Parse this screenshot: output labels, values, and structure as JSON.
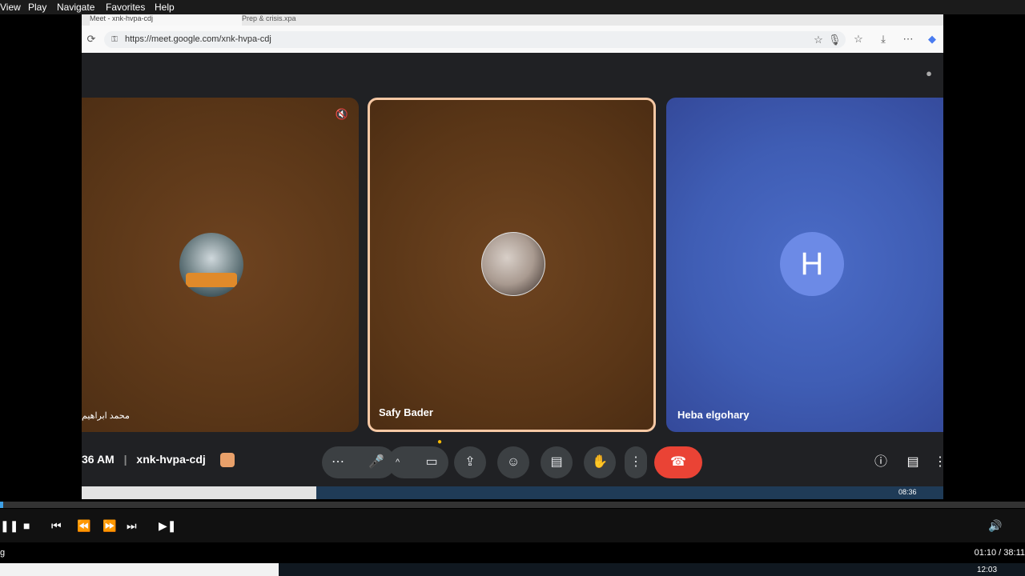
{
  "player": {
    "menu": [
      "View",
      "Play",
      "Navigate",
      "Favorites",
      "Help"
    ],
    "time": "01:10 / 38:11",
    "status_left": "g"
  },
  "browser": {
    "tab1_title": "Meet - xnk-hvpa-cdj",
    "tab2_title": "Prep & crisis.xpa",
    "url": "https://meet.google.com/xnk-hvpa-cdj"
  },
  "meet": {
    "participants": [
      {
        "name": "محمد ابراهيم",
        "avatar": "photo-room"
      },
      {
        "name": "Safy Bader",
        "avatar": "photo-person"
      },
      {
        "name": "Heba elgohary",
        "avatar_letter": "H"
      }
    ],
    "time_label": "36 AM",
    "meeting_code": "xnk-hvpa-cdj",
    "inner_clock": "08:36"
  },
  "os": {
    "clock": "12:03"
  },
  "colors": {
    "accent": "#ea4335",
    "highlight_border": "#f6c8a4",
    "avatar_letter_bg": "#6c8ae6"
  }
}
